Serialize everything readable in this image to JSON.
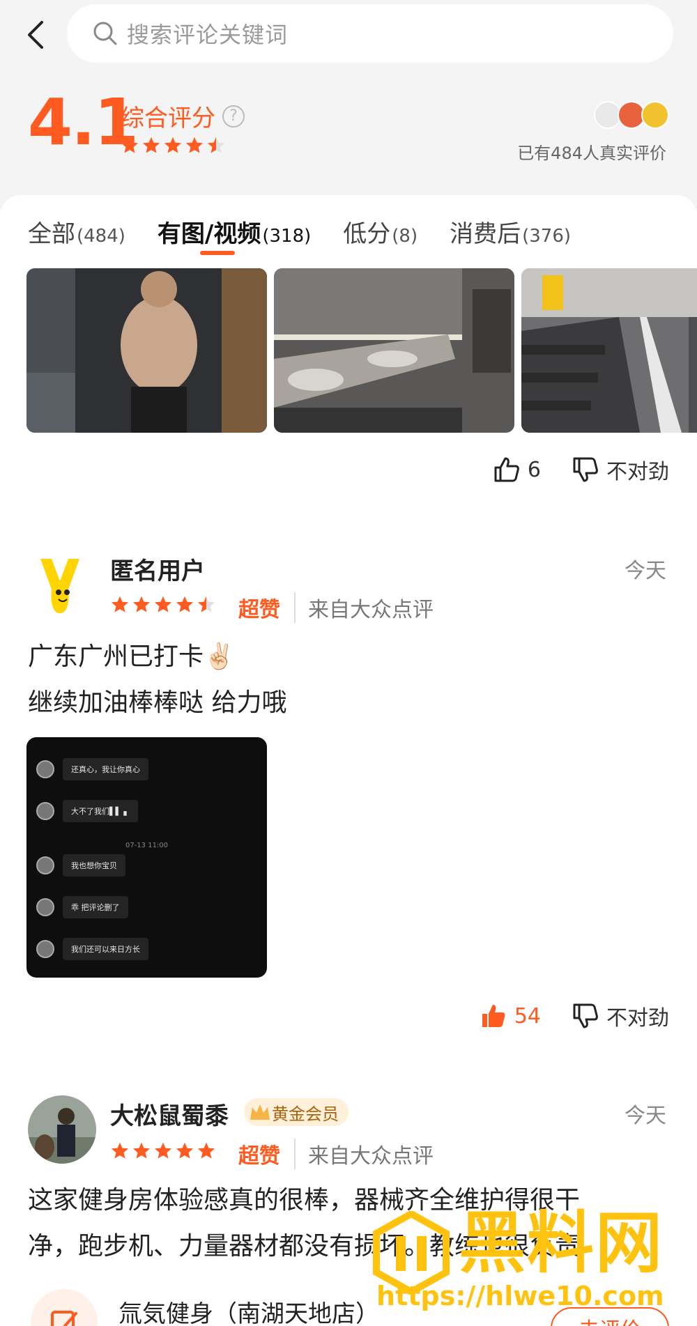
{
  "search": {
    "placeholder": "搜索评论关键词"
  },
  "summary": {
    "score": "4.1",
    "label": "综合评分",
    "help_symbol": "?",
    "rating": 4.5,
    "review_count_text": "已有484人真实评价"
  },
  "tabs": [
    {
      "label": "全部",
      "count": "(484)"
    },
    {
      "label": "有图/视频",
      "count": "(318)"
    },
    {
      "label": "低分",
      "count": "(8)"
    },
    {
      "label": "消费后",
      "count": "(376)"
    }
  ],
  "review0": {
    "likes": "6",
    "dislike_label": "不对劲"
  },
  "review1": {
    "user": "匿名用户",
    "time": "今天",
    "rating": 4.5,
    "grade": "超赞",
    "source": "来自大众点评",
    "text_line1": "广东广州已打卡✌🏻",
    "text_line2": "继续加油棒棒哒 给力哦",
    "chat": {
      "top_text": "还真心，我让你真心",
      "msgs": [
        "还真心，我让你真心",
        "大不了我们▌▌ ▖",
        "我也想你宝贝",
        "乖 把评论删了",
        "我们还可以来日方长"
      ],
      "time": "07-13 11:00"
    },
    "likes": "54",
    "dislike_label": "不对劲"
  },
  "review2": {
    "user": "大松鼠蜀黍",
    "badge": "黄金会员",
    "time": "今天",
    "rating": 5,
    "grade": "超赞",
    "source": "来自大众点评",
    "text_line1": "这家健身房体验感真的很棒，器械齐全维护得很干",
    "text_line2": "净，跑步机、力量器材都没有损坏。教练也很负责"
  },
  "shop": {
    "name": "氚気健身（南湖天地店）",
    "action": "去评价"
  },
  "watermark": {
    "title": "黑料网",
    "url": "https://hlwe10.com"
  },
  "colors": {
    "accent": "#ff5a1f",
    "gold": "#ffc20e"
  }
}
